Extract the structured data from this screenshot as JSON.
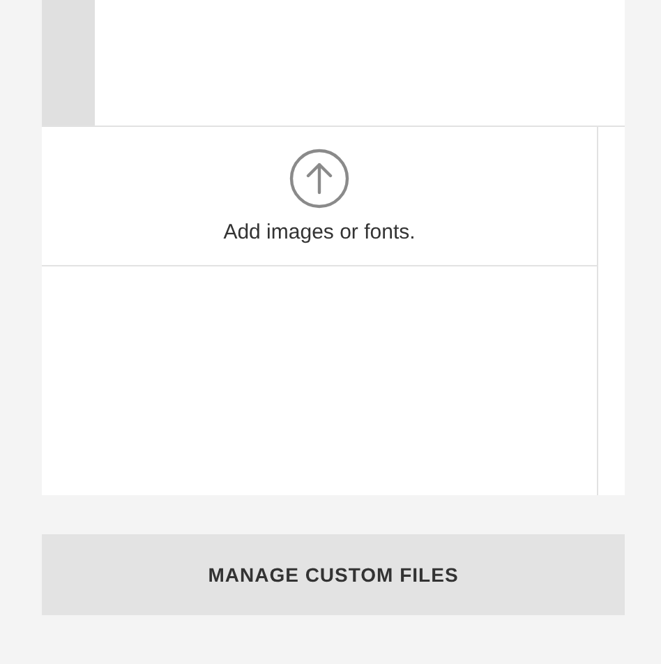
{
  "upload": {
    "label": "Add images or fonts."
  },
  "button": {
    "label": "MANAGE CUSTOM FILES"
  }
}
